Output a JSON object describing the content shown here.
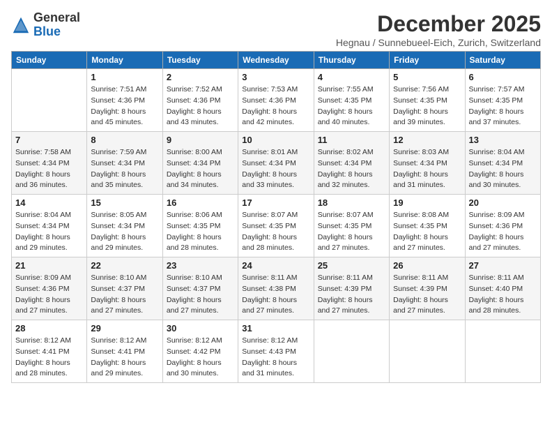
{
  "logo": {
    "general": "General",
    "blue": "Blue"
  },
  "header": {
    "month": "December 2025",
    "location": "Hegnau / Sunnebueel-Eich, Zurich, Switzerland"
  },
  "weekdays": [
    "Sunday",
    "Monday",
    "Tuesday",
    "Wednesday",
    "Thursday",
    "Friday",
    "Saturday"
  ],
  "weeks": [
    [
      {
        "day": "",
        "sunrise": "",
        "sunset": "",
        "daylight": ""
      },
      {
        "day": "1",
        "sunrise": "Sunrise: 7:51 AM",
        "sunset": "Sunset: 4:36 PM",
        "daylight": "Daylight: 8 hours and 45 minutes."
      },
      {
        "day": "2",
        "sunrise": "Sunrise: 7:52 AM",
        "sunset": "Sunset: 4:36 PM",
        "daylight": "Daylight: 8 hours and 43 minutes."
      },
      {
        "day": "3",
        "sunrise": "Sunrise: 7:53 AM",
        "sunset": "Sunset: 4:36 PM",
        "daylight": "Daylight: 8 hours and 42 minutes."
      },
      {
        "day": "4",
        "sunrise": "Sunrise: 7:55 AM",
        "sunset": "Sunset: 4:35 PM",
        "daylight": "Daylight: 8 hours and 40 minutes."
      },
      {
        "day": "5",
        "sunrise": "Sunrise: 7:56 AM",
        "sunset": "Sunset: 4:35 PM",
        "daylight": "Daylight: 8 hours and 39 minutes."
      },
      {
        "day": "6",
        "sunrise": "Sunrise: 7:57 AM",
        "sunset": "Sunset: 4:35 PM",
        "daylight": "Daylight: 8 hours and 37 minutes."
      }
    ],
    [
      {
        "day": "7",
        "sunrise": "Sunrise: 7:58 AM",
        "sunset": "Sunset: 4:34 PM",
        "daylight": "Daylight: 8 hours and 36 minutes."
      },
      {
        "day": "8",
        "sunrise": "Sunrise: 7:59 AM",
        "sunset": "Sunset: 4:34 PM",
        "daylight": "Daylight: 8 hours and 35 minutes."
      },
      {
        "day": "9",
        "sunrise": "Sunrise: 8:00 AM",
        "sunset": "Sunset: 4:34 PM",
        "daylight": "Daylight: 8 hours and 34 minutes."
      },
      {
        "day": "10",
        "sunrise": "Sunrise: 8:01 AM",
        "sunset": "Sunset: 4:34 PM",
        "daylight": "Daylight: 8 hours and 33 minutes."
      },
      {
        "day": "11",
        "sunrise": "Sunrise: 8:02 AM",
        "sunset": "Sunset: 4:34 PM",
        "daylight": "Daylight: 8 hours and 32 minutes."
      },
      {
        "day": "12",
        "sunrise": "Sunrise: 8:03 AM",
        "sunset": "Sunset: 4:34 PM",
        "daylight": "Daylight: 8 hours and 31 minutes."
      },
      {
        "day": "13",
        "sunrise": "Sunrise: 8:04 AM",
        "sunset": "Sunset: 4:34 PM",
        "daylight": "Daylight: 8 hours and 30 minutes."
      }
    ],
    [
      {
        "day": "14",
        "sunrise": "Sunrise: 8:04 AM",
        "sunset": "Sunset: 4:34 PM",
        "daylight": "Daylight: 8 hours and 29 minutes."
      },
      {
        "day": "15",
        "sunrise": "Sunrise: 8:05 AM",
        "sunset": "Sunset: 4:34 PM",
        "daylight": "Daylight: 8 hours and 29 minutes."
      },
      {
        "day": "16",
        "sunrise": "Sunrise: 8:06 AM",
        "sunset": "Sunset: 4:35 PM",
        "daylight": "Daylight: 8 hours and 28 minutes."
      },
      {
        "day": "17",
        "sunrise": "Sunrise: 8:07 AM",
        "sunset": "Sunset: 4:35 PM",
        "daylight": "Daylight: 8 hours and 28 minutes."
      },
      {
        "day": "18",
        "sunrise": "Sunrise: 8:07 AM",
        "sunset": "Sunset: 4:35 PM",
        "daylight": "Daylight: 8 hours and 27 minutes."
      },
      {
        "day": "19",
        "sunrise": "Sunrise: 8:08 AM",
        "sunset": "Sunset: 4:35 PM",
        "daylight": "Daylight: 8 hours and 27 minutes."
      },
      {
        "day": "20",
        "sunrise": "Sunrise: 8:09 AM",
        "sunset": "Sunset: 4:36 PM",
        "daylight": "Daylight: 8 hours and 27 minutes."
      }
    ],
    [
      {
        "day": "21",
        "sunrise": "Sunrise: 8:09 AM",
        "sunset": "Sunset: 4:36 PM",
        "daylight": "Daylight: 8 hours and 27 minutes."
      },
      {
        "day": "22",
        "sunrise": "Sunrise: 8:10 AM",
        "sunset": "Sunset: 4:37 PM",
        "daylight": "Daylight: 8 hours and 27 minutes."
      },
      {
        "day": "23",
        "sunrise": "Sunrise: 8:10 AM",
        "sunset": "Sunset: 4:37 PM",
        "daylight": "Daylight: 8 hours and 27 minutes."
      },
      {
        "day": "24",
        "sunrise": "Sunrise: 8:11 AM",
        "sunset": "Sunset: 4:38 PM",
        "daylight": "Daylight: 8 hours and 27 minutes."
      },
      {
        "day": "25",
        "sunrise": "Sunrise: 8:11 AM",
        "sunset": "Sunset: 4:39 PM",
        "daylight": "Daylight: 8 hours and 27 minutes."
      },
      {
        "day": "26",
        "sunrise": "Sunrise: 8:11 AM",
        "sunset": "Sunset: 4:39 PM",
        "daylight": "Daylight: 8 hours and 27 minutes."
      },
      {
        "day": "27",
        "sunrise": "Sunrise: 8:11 AM",
        "sunset": "Sunset: 4:40 PM",
        "daylight": "Daylight: 8 hours and 28 minutes."
      }
    ],
    [
      {
        "day": "28",
        "sunrise": "Sunrise: 8:12 AM",
        "sunset": "Sunset: 4:41 PM",
        "daylight": "Daylight: 8 hours and 28 minutes."
      },
      {
        "day": "29",
        "sunrise": "Sunrise: 8:12 AM",
        "sunset": "Sunset: 4:41 PM",
        "daylight": "Daylight: 8 hours and 29 minutes."
      },
      {
        "day": "30",
        "sunrise": "Sunrise: 8:12 AM",
        "sunset": "Sunset: 4:42 PM",
        "daylight": "Daylight: 8 hours and 30 minutes."
      },
      {
        "day": "31",
        "sunrise": "Sunrise: 8:12 AM",
        "sunset": "Sunset: 4:43 PM",
        "daylight": "Daylight: 8 hours and 31 minutes."
      },
      {
        "day": "",
        "sunrise": "",
        "sunset": "",
        "daylight": ""
      },
      {
        "day": "",
        "sunrise": "",
        "sunset": "",
        "daylight": ""
      },
      {
        "day": "",
        "sunrise": "",
        "sunset": "",
        "daylight": ""
      }
    ]
  ]
}
